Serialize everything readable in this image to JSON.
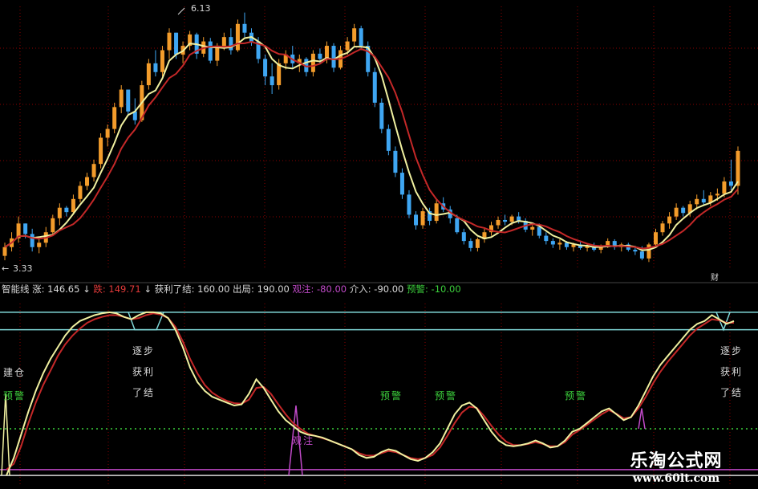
{
  "chart_data": {
    "type": "candlestick",
    "price_panel": {
      "high_label": "6.13",
      "low_label": "3.33",
      "corner_mark": "财",
      "price_range": [
        3.2,
        6.2
      ],
      "x_range": [
        0,
        136
      ],
      "candles": [
        [
          3.35,
          3.5,
          3.3,
          3.45
        ],
        [
          3.45,
          3.62,
          3.4,
          3.55
        ],
        [
          3.55,
          3.8,
          3.5,
          3.72
        ],
        [
          3.72,
          3.7,
          3.55,
          3.6
        ],
        [
          3.6,
          3.66,
          3.4,
          3.45
        ],
        [
          3.45,
          3.55,
          3.38,
          3.5
        ],
        [
          3.5,
          3.68,
          3.45,
          3.62
        ],
        [
          3.62,
          3.82,
          3.58,
          3.78
        ],
        [
          3.78,
          3.95,
          3.7,
          3.9
        ],
        [
          3.9,
          3.92,
          3.8,
          3.85
        ],
        [
          3.85,
          4.05,
          3.82,
          4.0
        ],
        [
          4.0,
          4.2,
          3.96,
          4.15
        ],
        [
          4.15,
          4.3,
          4.1,
          4.25
        ],
        [
          4.25,
          4.45,
          4.2,
          4.4
        ],
        [
          4.4,
          4.75,
          4.35,
          4.7
        ],
        [
          4.7,
          4.85,
          4.6,
          4.8
        ],
        [
          4.8,
          5.1,
          4.75,
          5.05
        ],
        [
          5.05,
          5.3,
          4.98,
          5.25
        ],
        [
          5.25,
          5.2,
          4.95,
          5.0
        ],
        [
          5.0,
          5.15,
          4.85,
          4.9
        ],
        [
          4.9,
          5.35,
          4.88,
          5.3
        ],
        [
          5.3,
          5.6,
          5.25,
          5.55
        ],
        [
          5.55,
          5.7,
          5.4,
          5.45
        ],
        [
          5.45,
          5.75,
          5.4,
          5.7
        ],
        [
          5.7,
          5.95,
          5.6,
          5.9
        ],
        [
          5.9,
          5.85,
          5.6,
          5.65
        ],
        [
          5.65,
          5.8,
          5.55,
          5.75
        ],
        [
          5.75,
          5.92,
          5.7,
          5.88
        ],
        [
          5.88,
          5.9,
          5.6,
          5.66
        ],
        [
          5.66,
          5.85,
          5.62,
          5.8
        ],
        [
          5.8,
          5.84,
          5.55,
          5.58
        ],
        [
          5.58,
          5.78,
          5.52,
          5.74
        ],
        [
          5.74,
          5.9,
          5.7,
          5.85
        ],
        [
          5.85,
          5.95,
          5.65,
          5.7
        ],
        [
          5.7,
          6.05,
          5.68,
          6.0
        ],
        [
          6.0,
          6.13,
          5.85,
          5.9
        ],
        [
          5.9,
          5.95,
          5.75,
          5.8
        ],
        [
          5.8,
          5.85,
          5.55,
          5.6
        ],
        [
          5.6,
          5.65,
          5.3,
          5.4
        ],
        [
          5.4,
          5.55,
          5.2,
          5.3
        ],
        [
          5.3,
          5.6,
          5.25,
          5.55
        ],
        [
          5.55,
          5.7,
          5.48,
          5.65
        ],
        [
          5.65,
          5.75,
          5.5,
          5.55
        ],
        [
          5.55,
          5.65,
          5.45,
          5.6
        ],
        [
          5.6,
          5.62,
          5.4,
          5.45
        ],
        [
          5.45,
          5.7,
          5.4,
          5.66
        ],
        [
          5.66,
          5.72,
          5.55,
          5.6
        ],
        [
          5.6,
          5.8,
          5.55,
          5.75
        ],
        [
          5.75,
          5.78,
          5.45,
          5.5
        ],
        [
          5.5,
          5.75,
          5.48,
          5.7
        ],
        [
          5.7,
          5.85,
          5.65,
          5.8
        ],
        [
          5.8,
          6.0,
          5.75,
          5.95
        ],
        [
          5.95,
          5.98,
          5.7,
          5.75
        ],
        [
          5.75,
          5.8,
          5.4,
          5.45
        ],
        [
          5.45,
          5.5,
          5.05,
          5.1
        ],
        [
          5.1,
          5.15,
          4.75,
          4.8
        ],
        [
          4.8,
          4.85,
          4.5,
          4.55
        ],
        [
          4.55,
          4.6,
          4.25,
          4.3
        ],
        [
          4.3,
          4.35,
          4.0,
          4.05
        ],
        [
          4.05,
          4.1,
          3.78,
          3.82
        ],
        [
          3.82,
          3.86,
          3.65,
          3.7
        ],
        [
          3.7,
          3.9,
          3.66,
          3.86
        ],
        [
          3.86,
          3.9,
          3.7,
          3.75
        ],
        [
          3.75,
          4.0,
          3.72,
          3.95
        ],
        [
          3.95,
          4.02,
          3.85,
          3.88
        ],
        [
          3.88,
          3.92,
          3.72,
          3.78
        ],
        [
          3.78,
          3.82,
          3.6,
          3.62
        ],
        [
          3.62,
          3.66,
          3.48,
          3.52
        ],
        [
          3.52,
          3.55,
          3.4,
          3.44
        ],
        [
          3.44,
          3.56,
          3.4,
          3.54
        ],
        [
          3.54,
          3.66,
          3.5,
          3.62
        ],
        [
          3.62,
          3.74,
          3.58,
          3.7
        ],
        [
          3.7,
          3.8,
          3.66,
          3.76
        ],
        [
          3.76,
          3.82,
          3.7,
          3.74
        ],
        [
          3.74,
          3.82,
          3.7,
          3.8
        ],
        [
          3.8,
          3.85,
          3.72,
          3.75
        ],
        [
          3.75,
          3.78,
          3.62,
          3.65
        ],
        [
          3.65,
          3.7,
          3.58,
          3.68
        ],
        [
          3.68,
          3.72,
          3.55,
          3.58
        ],
        [
          3.58,
          3.62,
          3.48,
          3.52
        ],
        [
          3.52,
          3.55,
          3.44,
          3.48
        ],
        [
          3.48,
          3.54,
          3.42,
          3.5
        ],
        [
          3.5,
          3.52,
          3.42,
          3.45
        ],
        [
          3.45,
          3.5,
          3.4,
          3.48
        ],
        [
          3.48,
          3.52,
          3.42,
          3.44
        ],
        [
          3.44,
          3.48,
          3.4,
          3.46
        ],
        [
          3.46,
          3.5,
          3.4,
          3.42
        ],
        [
          3.42,
          3.48,
          3.38,
          3.46
        ],
        [
          3.46,
          3.55,
          3.44,
          3.52
        ],
        [
          3.52,
          3.54,
          3.42,
          3.45
        ],
        [
          3.45,
          3.5,
          3.4,
          3.48
        ],
        [
          3.48,
          3.5,
          3.4,
          3.42
        ],
        [
          3.42,
          3.46,
          3.36,
          3.4
        ],
        [
          3.4,
          3.46,
          3.3,
          3.32
        ],
        [
          3.32,
          3.5,
          3.28,
          3.48
        ],
        [
          3.48,
          3.66,
          3.45,
          3.62
        ],
        [
          3.62,
          3.75,
          3.58,
          3.72
        ],
        [
          3.72,
          3.85,
          3.66,
          3.8
        ],
        [
          3.8,
          3.95,
          3.76,
          3.9
        ],
        [
          3.9,
          3.92,
          3.8,
          3.84
        ],
        [
          3.84,
          3.98,
          3.8,
          3.94
        ],
        [
          3.94,
          4.05,
          3.88,
          4.0
        ],
        [
          4.0,
          4.1,
          3.92,
          3.96
        ],
        [
          3.96,
          4.08,
          3.92,
          4.04
        ],
        [
          4.04,
          4.12,
          3.98,
          4.06
        ],
        [
          4.06,
          4.25,
          4.02,
          4.2
        ],
        [
          4.2,
          4.45,
          4.1,
          4.15
        ],
        [
          4.15,
          4.6,
          4.05,
          4.55
        ]
      ],
      "series": [
        {
          "name": "",
          "color": "#f0f0a0"
        },
        {
          "name": "",
          "color": "#c42828"
        }
      ]
    },
    "indicator_panel": {
      "header": [
        {
          "text": "智能线",
          "color": "#d9d9d9"
        },
        {
          "text": "涨: 146.65",
          "color": "#d9d9d9"
        },
        {
          "text": "↓",
          "color": "#d9d9d9"
        },
        {
          "text": "跌:",
          "color": "#e23a3a"
        },
        {
          "text": "149.71",
          "color": "#e23a3a"
        },
        {
          "text": "↓",
          "color": "#d9d9d9"
        },
        {
          "text": "获利了结: 160.00",
          "color": "#d9d9d9"
        },
        {
          "text": "出局: 190.00",
          "color": "#d9d9d9"
        },
        {
          "text": "观注: -80.00",
          "color": "#c04ac8"
        },
        {
          "text": "介入: -90.00",
          "color": "#d9d9d9"
        },
        {
          "text": "预警: -10.00",
          "color": "#3ccf3c"
        }
      ],
      "y_range": [
        -105,
        205
      ],
      "levels": [
        {
          "value": 190,
          "color": "#7fd7d7",
          "style": "solid"
        },
        {
          "value": 160,
          "color": "#7fd7d7",
          "style": "solid"
        },
        {
          "value": -10,
          "color": "#3ccf3c",
          "style": "dotted"
        },
        {
          "value": -80,
          "color": "#c04ac8",
          "style": "solid"
        },
        {
          "value": -90,
          "color": "#d9d9d9",
          "style": "solid"
        }
      ],
      "line_up": [
        -90,
        -60,
        -20,
        20,
        55,
        85,
        110,
        130,
        150,
        165,
        175,
        180,
        185,
        188,
        190,
        188,
        182,
        178,
        185,
        190,
        190,
        188,
        180,
        160,
        130,
        95,
        70,
        55,
        45,
        40,
        35,
        30,
        32,
        50,
        75,
        60,
        40,
        20,
        5,
        -5,
        -15,
        -20,
        -22,
        -25,
        -30,
        -35,
        -40,
        -45,
        -55,
        -60,
        -58,
        -50,
        -45,
        -48,
        -55,
        -62,
        -65,
        -60,
        -50,
        -35,
        -10,
        15,
        30,
        35,
        25,
        5,
        -15,
        -30,
        -38,
        -40,
        -38,
        -35,
        -30,
        -35,
        -42,
        -40,
        -30,
        -15,
        -10,
        0,
        10,
        20,
        25,
        15,
        5,
        10,
        30,
        55,
        80,
        100,
        115,
        130,
        145,
        160,
        170,
        175,
        185,
        178,
        170,
        175
      ],
      "line_down": [
        -80,
        -70,
        -40,
        0,
        35,
        65,
        90,
        115,
        135,
        150,
        162,
        172,
        178,
        182,
        185,
        185,
        182,
        178,
        180,
        185,
        188,
        186,
        180,
        165,
        140,
        110,
        85,
        65,
        52,
        44,
        38,
        34,
        33,
        40,
        60,
        62,
        50,
        32,
        15,
        0,
        -10,
        -18,
        -22,
        -26,
        -30,
        -35,
        -40,
        -45,
        -52,
        -56,
        -56,
        -52,
        -48,
        -50,
        -55,
        -60,
        -62,
        -60,
        -55,
        -42,
        -22,
        0,
        18,
        28,
        26,
        12,
        -5,
        -20,
        -32,
        -38,
        -38,
        -36,
        -33,
        -36,
        -40,
        -40,
        -33,
        -20,
        -12,
        -3,
        6,
        15,
        22,
        16,
        8,
        10,
        25,
        45,
        68,
        88,
        105,
        120,
        135,
        150,
        162,
        170,
        178,
        176,
        172,
        172
      ],
      "markers": [
        {
          "text": "建仓",
          "color": "#d9d9d9"
        },
        {
          "text": "预警",
          "color": "#3ccf3c"
        },
        {
          "text": "逐步",
          "color": "#d9d9d9"
        },
        {
          "text": "获利",
          "color": "#d9d9d9"
        },
        {
          "text": "了结",
          "color": "#d9d9d9"
        },
        {
          "text": "观注",
          "color": "#c04ac8"
        },
        {
          "text": "预警",
          "color": "#3ccf3c"
        },
        {
          "text": "预警",
          "color": "#3ccf3c"
        },
        {
          "text": "预警",
          "color": "#3ccf3c"
        },
        {
          "text": "逐步",
          "color": "#d9d9d9"
        },
        {
          "text": "获利",
          "color": "#d9d9d9"
        },
        {
          "text": "了结",
          "color": "#d9d9d9"
        }
      ]
    }
  },
  "watermark": {
    "name": "乐淘公式网",
    "url": "www.60lt.com"
  },
  "colors": {
    "up_candle": "#f39c2b",
    "down_candle": "#3fa6f2",
    "background": "#000000",
    "grid": "#8b0000"
  }
}
